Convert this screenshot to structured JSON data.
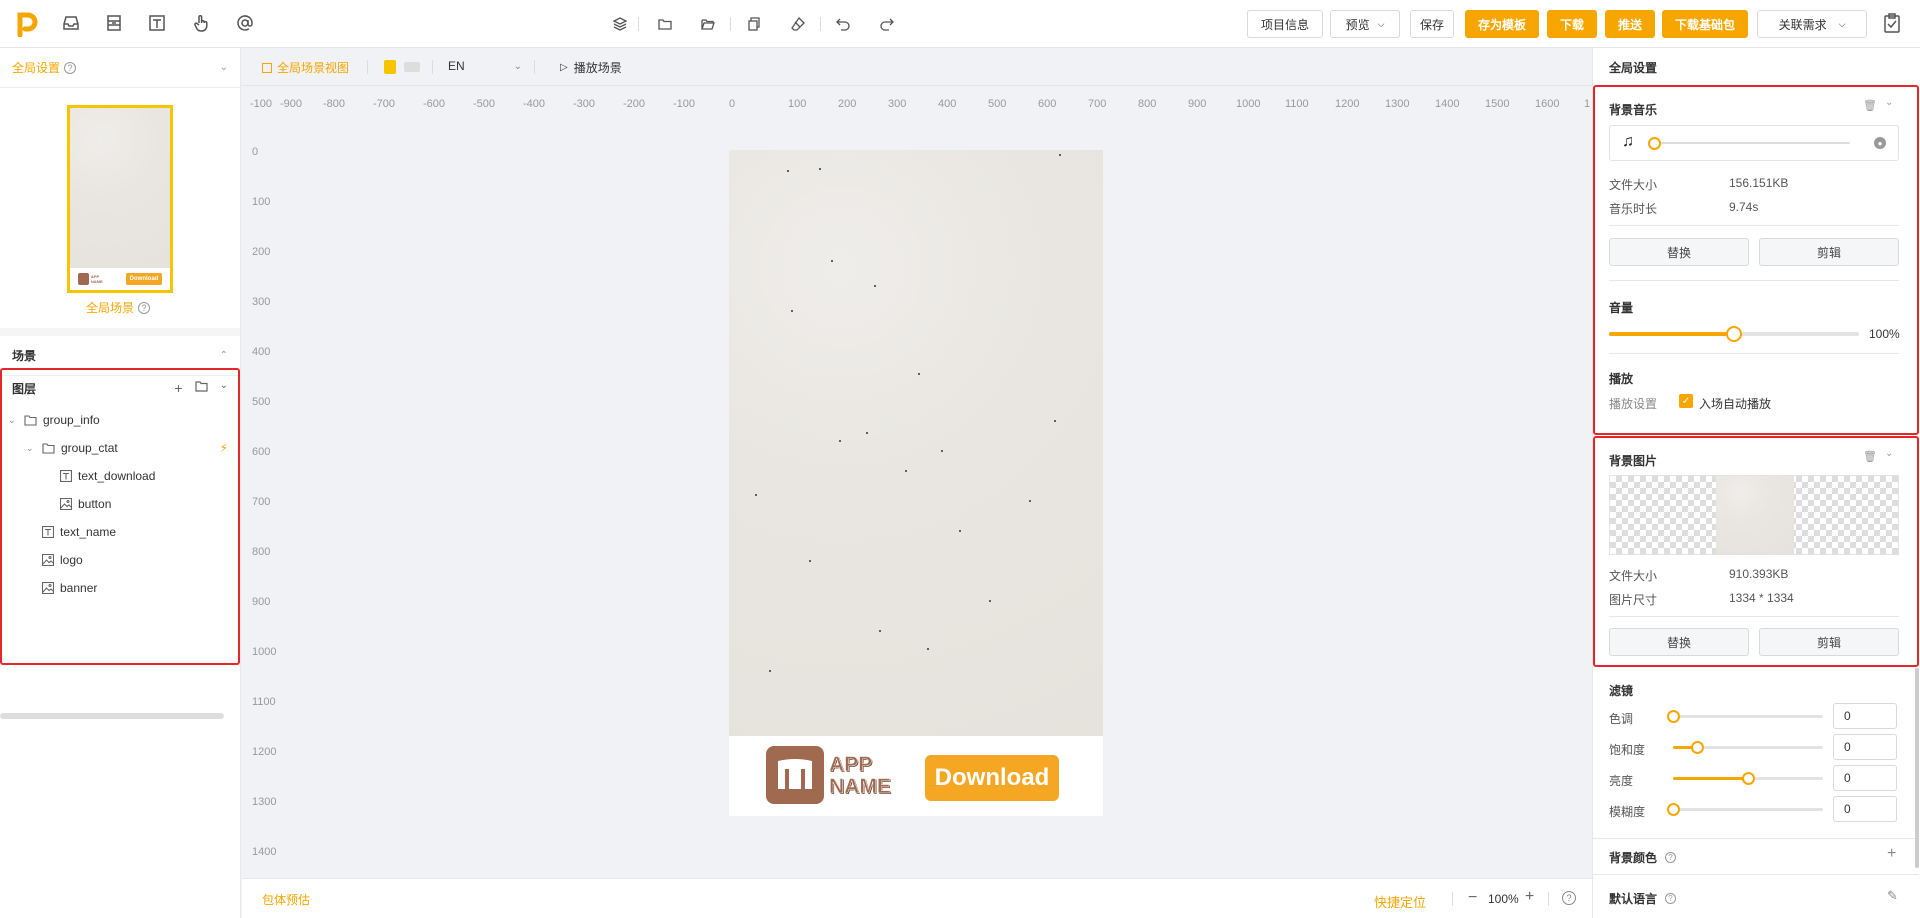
{
  "topbar": {
    "left_icons": [
      "logo-icon",
      "inbox-icon",
      "layout-icon",
      "text-icon",
      "hand-pointer-icon",
      "at-icon"
    ],
    "center_icons": [
      "layers-icon",
      "folder-icon",
      "folder-open-icon",
      "copy-icon",
      "eraser-icon",
      "undo-icon",
      "redo-icon"
    ],
    "project_info": "项目信息",
    "preview": "预览",
    "save": "保存",
    "save_template": "存为模板",
    "download": "下载",
    "push": "推送",
    "download_base": "下载基础包",
    "related": "关联需求"
  },
  "left": {
    "global_settings": "全局设置",
    "global_scene": "全局场景",
    "scene": "场景",
    "layers": "图层",
    "thumb_app": "APP NAME",
    "thumb_download": "Download",
    "tree": [
      {
        "label": "group_info",
        "type": "folder",
        "level": 0,
        "expanded": true
      },
      {
        "label": "group_ctat",
        "type": "folder",
        "level": 1,
        "expanded": true
      },
      {
        "label": "text_download",
        "type": "text",
        "level": 2
      },
      {
        "label": "button",
        "type": "image",
        "level": 2
      },
      {
        "label": "text_name",
        "type": "text",
        "level": 1
      },
      {
        "label": "logo",
        "type": "image",
        "level": 1
      },
      {
        "label": "banner",
        "type": "image",
        "level": 1
      }
    ]
  },
  "canvas": {
    "global_scene_view": "全局场景视图",
    "language": "EN",
    "play_scene": "播放场景",
    "ruler_h": [
      "-100",
      "-900",
      "-800",
      "-700",
      "-600",
      "-500",
      "-400",
      "-300",
      "-200",
      "-100",
      "0",
      "100",
      "200",
      "300",
      "400",
      "500",
      "600",
      "700",
      "800",
      "900",
      "1000",
      "1100",
      "1200",
      "1300",
      "1400",
      "1500",
      "1600",
      "1"
    ],
    "ruler_v": [
      "0",
      "100",
      "200",
      "300",
      "400",
      "500",
      "600",
      "700",
      "800",
      "900",
      "1000",
      "1100",
      "1200",
      "1300",
      "1400"
    ],
    "app_name_line1": "APP",
    "app_name_line2": "NAME",
    "download_btn": "Download",
    "accent": "#f7a600"
  },
  "statusbar": {
    "estimate": "包体预估",
    "quick_locate": "快捷定位",
    "zoom": "100%"
  },
  "right": {
    "title": "全局设置",
    "bg_music": {
      "title": "背景音乐",
      "file_size_label": "文件大小",
      "file_size": "156.151KB",
      "duration_label": "音乐时长",
      "duration": "9.74s",
      "replace": "替换",
      "edit": "剪辑"
    },
    "volume": {
      "title": "音量",
      "value_label": "100%",
      "value": 0.5
    },
    "playback": {
      "title": "播放",
      "setting_label": "播放设置",
      "auto_play": "入场自动播放",
      "checked": true
    },
    "bg_image": {
      "title": "背景图片",
      "file_size_label": "文件大小",
      "file_size": "910.393KB",
      "dims_label": "图片尺寸",
      "dims": "1334 * 1334",
      "replace": "替换",
      "edit": "剪辑"
    },
    "filter": {
      "title": "滤镜",
      "items": [
        {
          "label": "色调",
          "value": "0",
          "level": 0
        },
        {
          "label": "饱和度",
          "value": "0",
          "level": 0.16
        },
        {
          "label": "亮度",
          "value": "0",
          "level": 0.5
        },
        {
          "label": "模糊度",
          "value": "0",
          "level": 0
        }
      ]
    },
    "bg_color": "背景颜色",
    "default_lang": "默认语言"
  }
}
